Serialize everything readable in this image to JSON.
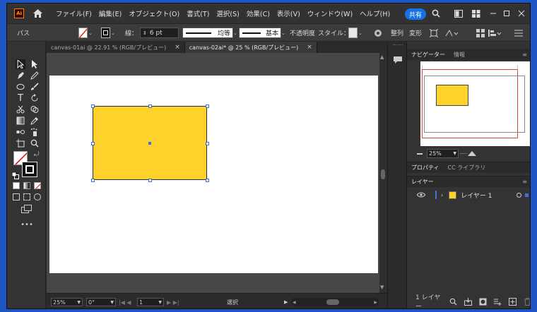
{
  "app": {
    "logo": "Ai",
    "share_label": "共有"
  },
  "menu": [
    "ファイル(F)",
    "編集(E)",
    "オブジェクト(O)",
    "書式(T)",
    "選択(S)",
    "効果(C)",
    "表示(V)",
    "ウィンドウ(W)",
    "ヘルプ(H)"
  ],
  "control": {
    "path_label": "パス",
    "stroke_label": "線：",
    "stroke_value": "6 pt",
    "profile_label": "均等",
    "brush_label": "基本",
    "opacity_label": "不透明度",
    "style_label": "スタイル：",
    "align_label": "整列",
    "transform_label": "変形"
  },
  "tabs": [
    {
      "label": "canvas-01ai @ 22.91 % (RGB/プレビュー)",
      "close": "×"
    },
    {
      "label": "canvas-02ai* @ 25 % (RGB/プレビュー)",
      "close": "×"
    }
  ],
  "status": {
    "zoom": "25%",
    "angle": "0°",
    "artboard": "1",
    "tool": "選択"
  },
  "navigator": {
    "tab_navigator": "ナビゲーター",
    "tab_info": "情報",
    "zoom": "25%"
  },
  "properties": {
    "tab_properties": "プロパティ",
    "tab_libraries": "CC ライブラリ"
  },
  "layers": {
    "tab": "レイヤー",
    "layer_name": "レイヤー 1",
    "count": "1 レイヤー",
    "layer_color": "#4a6de0",
    "swatch_color": "#fdd32b"
  },
  "colors": {
    "shape_fill": "#fdd32b",
    "accent": "#1473e6",
    "selection": "#3b6fd6"
  },
  "icons": [
    "home-icon",
    "search-icon",
    "minimize-icon",
    "maximize-icon",
    "close-icon",
    "selection-tool-icon",
    "pen-tool-icon",
    "type-tool-icon",
    "eye-icon"
  ]
}
